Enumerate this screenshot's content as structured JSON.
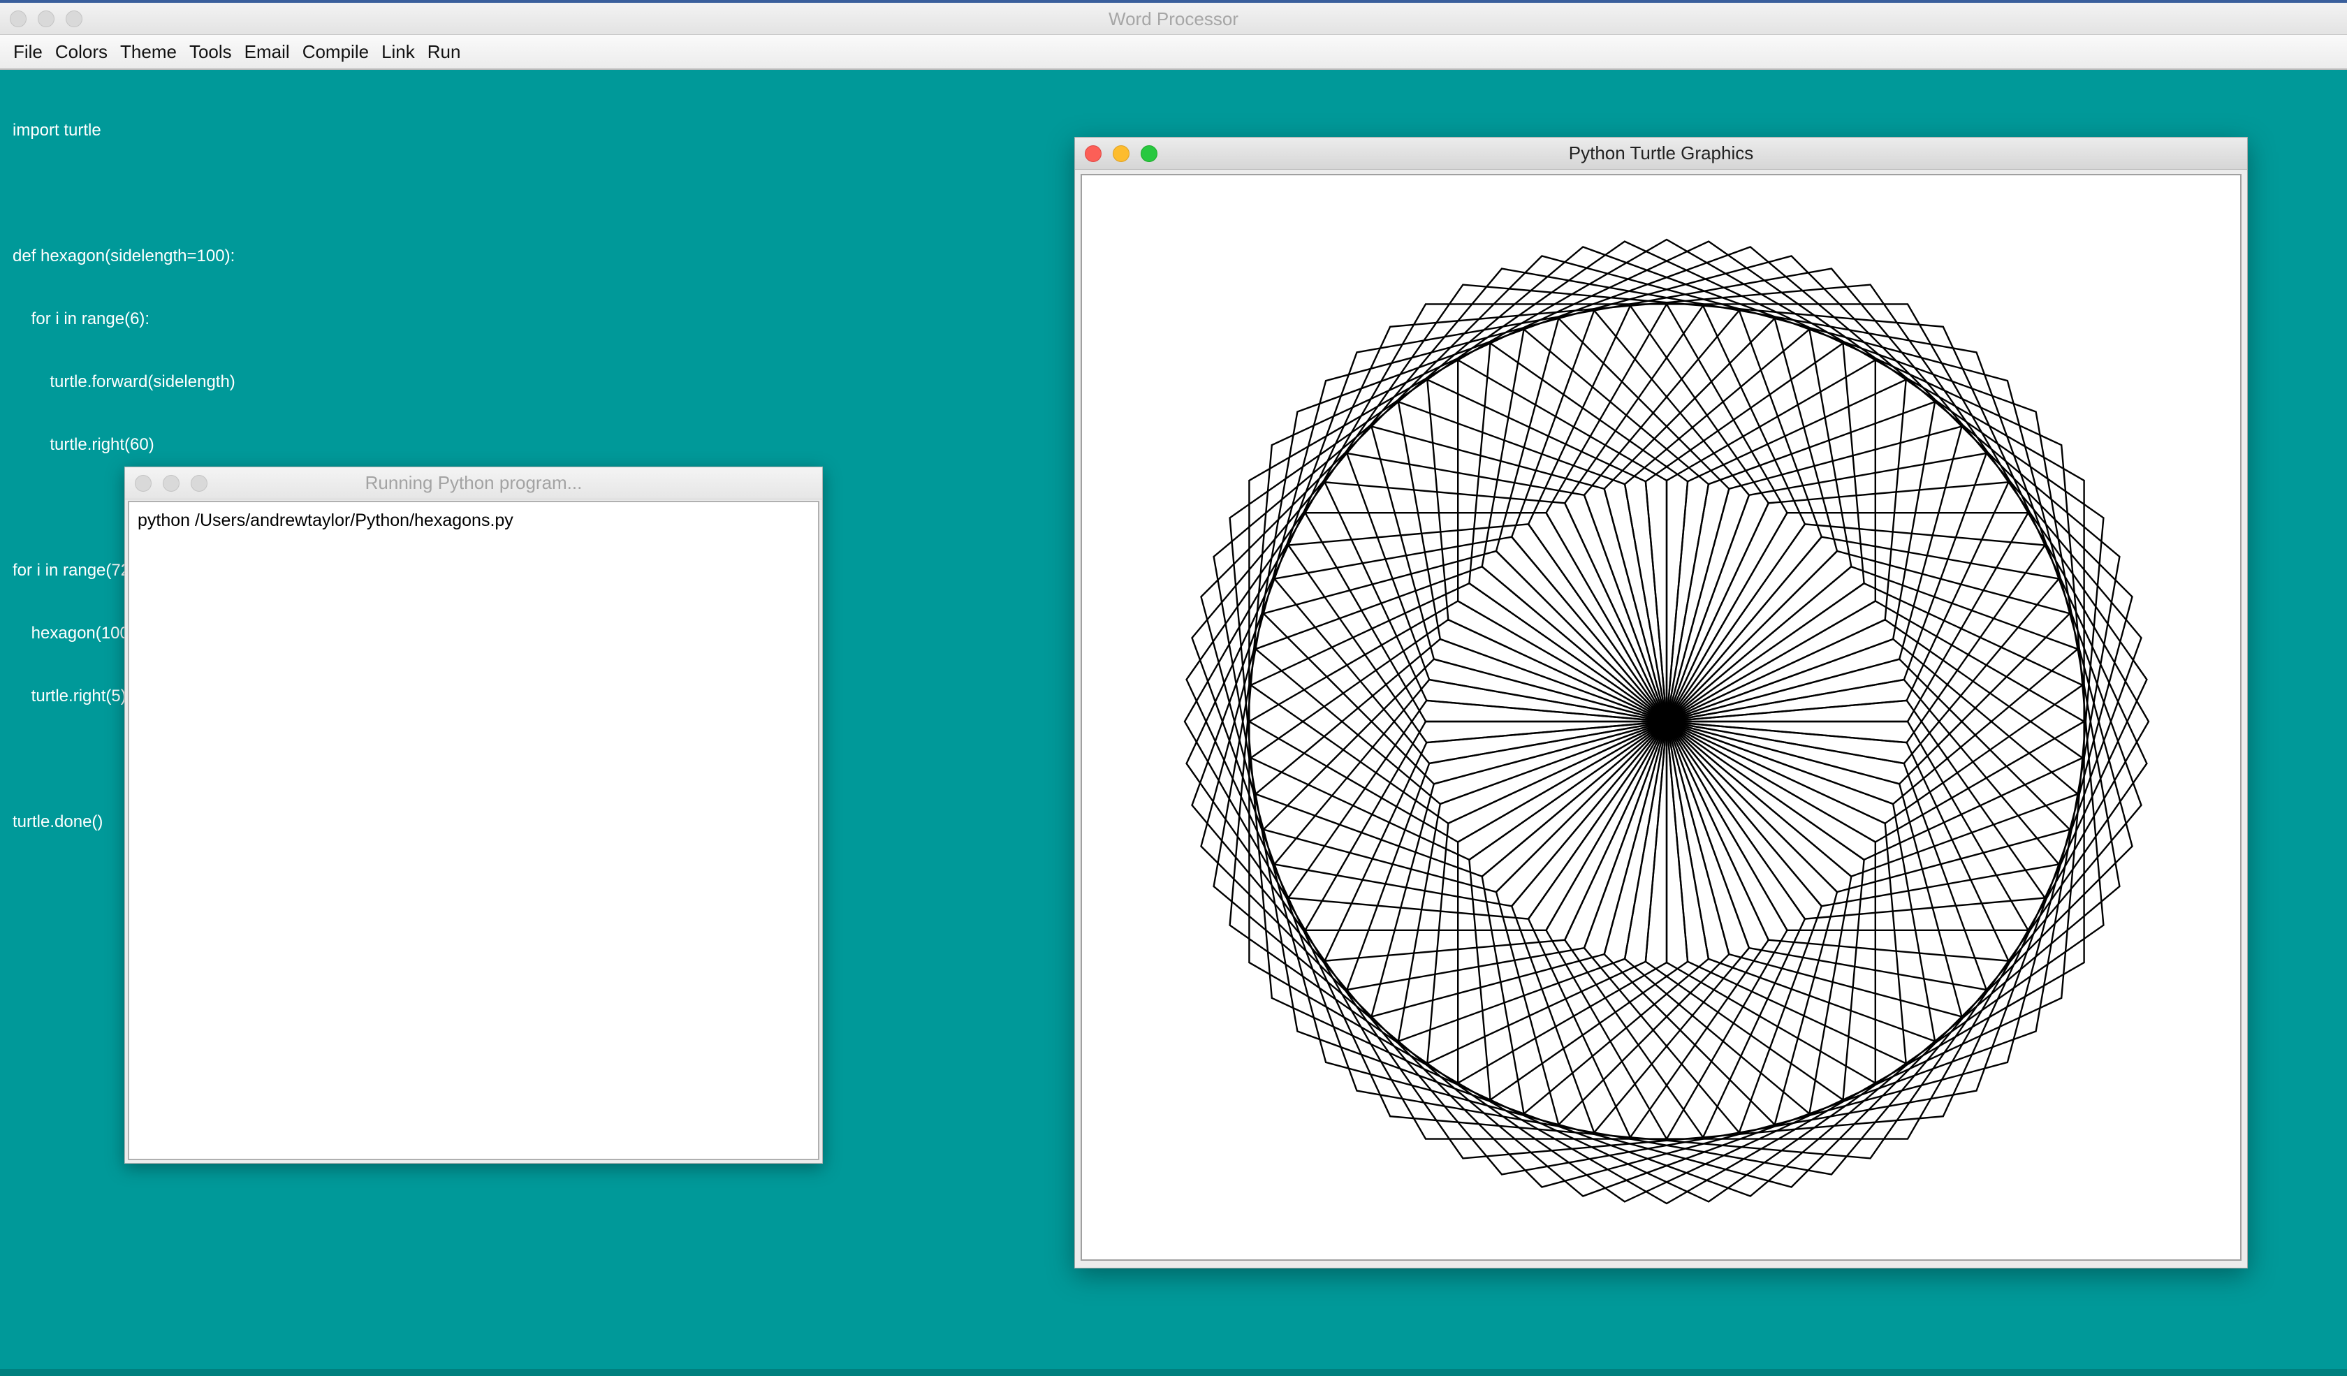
{
  "main_window": {
    "title": "Word Processor",
    "background_color": "#009999"
  },
  "menubar": {
    "items": [
      "File",
      "Colors",
      "Theme",
      "Tools",
      "Email",
      "Compile",
      "Link",
      "Run"
    ]
  },
  "editor": {
    "text_color": "#ffffff",
    "code_lines": [
      "import turtle",
      "",
      "def hexagon(sidelength=100):",
      "    for i in range(6):",
      "        turtle.forward(sidelength)",
      "        turtle.right(60)",
      "",
      "for i in range(72):",
      "    hexagon(100)",
      "    turtle.right(5)",
      "",
      "turtle.done()"
    ]
  },
  "run_window": {
    "title": "Running Python program...",
    "console_output": "python /Users/andrewtaylor/Python/hexagons.py"
  },
  "turtle_window": {
    "title": "Python Turtle Graphics",
    "drawing": {
      "shape": "hexagon",
      "side_length": 100,
      "repetitions": 72,
      "turn_degrees": 5,
      "stroke_color": "#000000"
    }
  }
}
